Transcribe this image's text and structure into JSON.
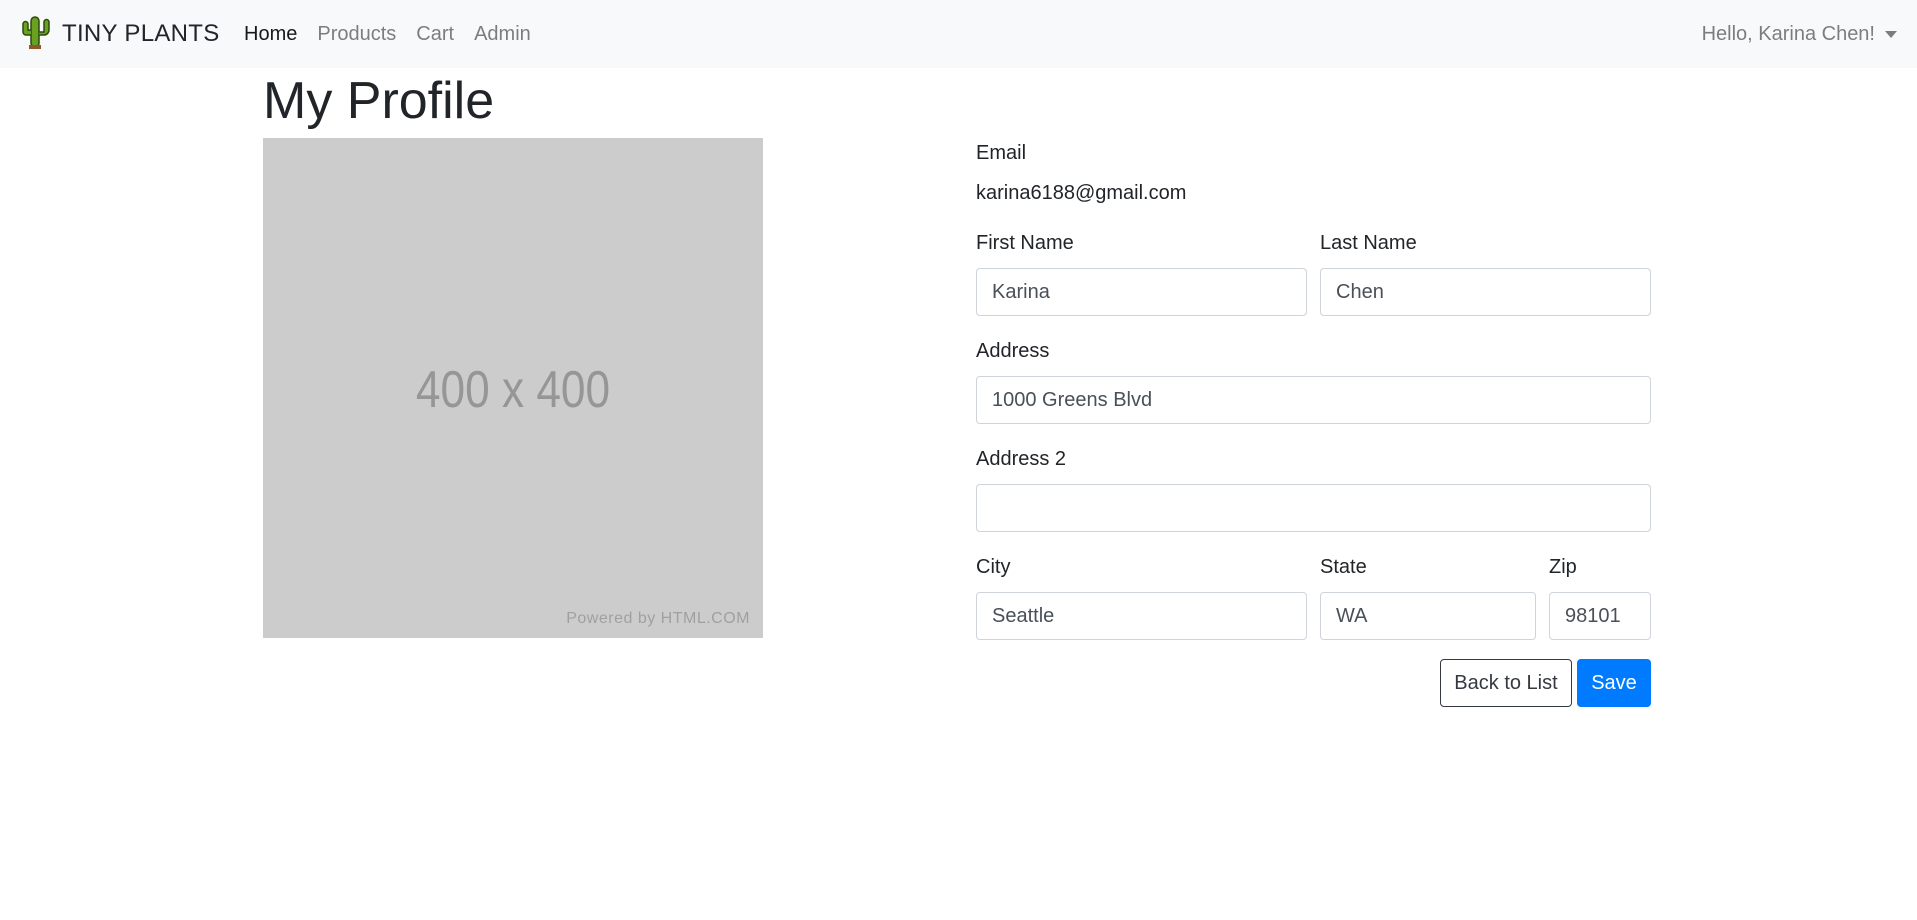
{
  "navbar": {
    "brand": "TINY PLANTS",
    "links": [
      "Home",
      "Products",
      "Cart",
      "Admin"
    ],
    "user_greeting": "Hello, Karina Chen!"
  },
  "page": {
    "title": "My Profile"
  },
  "image_placeholder": {
    "dimensions_text": "400 x 400",
    "powered_by": "Powered by HTML.COM"
  },
  "form": {
    "email_label": "Email",
    "email_value": "karina6188@gmail.com",
    "first_name_label": "First Name",
    "first_name_value": "Karina",
    "last_name_label": "Last Name",
    "last_name_value": "Chen",
    "address_label": "Address",
    "address_value": "1000 Greens Blvd",
    "address2_label": "Address 2",
    "address2_value": "",
    "city_label": "City",
    "city_value": "Seattle",
    "state_label": "State",
    "state_value": "WA",
    "zip_label": "Zip",
    "zip_value": "98101",
    "back_button": "Back to List",
    "save_button": "Save"
  },
  "colors": {
    "navbar_bg": "#f8f9fa",
    "primary": "#007bff",
    "placeholder_bg": "#cccccc",
    "cactus": "#6aa121"
  },
  "icons": {
    "brand": "cactus-icon",
    "user_menu": "caret-down-icon"
  }
}
